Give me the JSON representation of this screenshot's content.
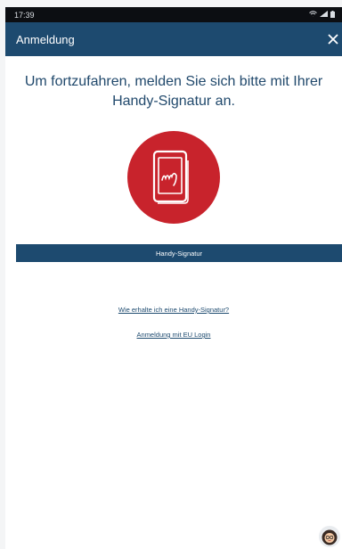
{
  "status_bar": {
    "time": "17:39"
  },
  "app_bar": {
    "title": "Anmeldung",
    "close_icon": "close-icon"
  },
  "main": {
    "heading": "Um fortzufahren, melden Sie sich bitte mit Ihrer Handy-Signatur an.",
    "logo_icon": "handy-signatur-phone-icon",
    "signature_button_label": "Handy-Signatur",
    "links": [
      {
        "label": "Wie erhalte ich eine Handy-Signatur?"
      },
      {
        "label": "Anmeldung mit EU Login"
      }
    ]
  },
  "assistant": {
    "icon": "assistant-avatar-icon"
  },
  "colors": {
    "primary": "#1d4a6f",
    "brand_red": "#c8232c",
    "heading_text": "#21496c"
  }
}
